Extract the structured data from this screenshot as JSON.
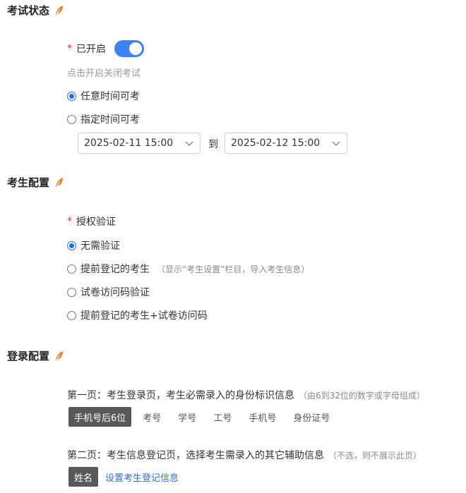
{
  "exam_status": {
    "title": "考试状态",
    "enabled_label": "已开启",
    "hint": "点击开启关闭考试",
    "options": [
      "任意时间可考",
      "指定时间可考"
    ],
    "start_time": "2025-02-11 15:00",
    "to_label": "到",
    "end_time": "2025-02-12 15:00"
  },
  "candidate_config": {
    "title": "考生配置",
    "auth_label": "授权验证",
    "options": [
      "无需验证",
      "提前登记的考生",
      "试卷访问码验证",
      "提前登记的考生+试卷访问码"
    ],
    "option2_note": "（显示“考生设置”栏目，导入考生信息）"
  },
  "login_config": {
    "title": "登录配置",
    "page1_text": "第一页：考生登录页，考生必需录入的身份标识信息",
    "page1_note": "（由6到32位的数字或字母组成）",
    "page1_tags": [
      "手机号后6位",
      "考号",
      "学号",
      "工号",
      "手机号",
      "身份证号"
    ],
    "page2_text": "第二页：考生信息登记页，选择考生需录入的其它辅助信息",
    "page2_note": "（不选，则不展示此页）",
    "page2_tag": "姓名",
    "page2_link": "设置考生登记信息"
  },
  "colors": {
    "accent": "#3b82f6",
    "radio": "#1e6fe6",
    "required": "#e53935",
    "active_tag": "#595959",
    "link": "#2f6fd6"
  }
}
